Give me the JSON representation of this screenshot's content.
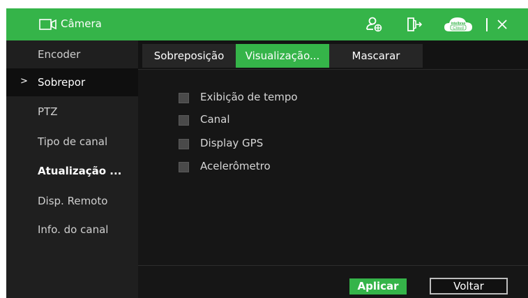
{
  "window": {
    "title": "Câmera",
    "cloud_brand": "intelbras",
    "cloud_label": "Cloud"
  },
  "sidebar": {
    "items": [
      {
        "label": "Encoder"
      },
      {
        "label": "Sobrepor",
        "selected": true
      },
      {
        "label": "PTZ"
      },
      {
        "label": "Tipo de canal"
      },
      {
        "label": "Atualização ..."
      },
      {
        "label": "Disp. Remoto"
      },
      {
        "label": "Info. do canal"
      }
    ],
    "selected_marker": ">"
  },
  "tabs": [
    {
      "label": "Sobreposição"
    },
    {
      "label": "Visualização...",
      "active": true
    },
    {
      "label": "Mascarar"
    }
  ],
  "options": [
    {
      "label": "Exibição de tempo",
      "checked": false
    },
    {
      "label": "Canal",
      "checked": false
    },
    {
      "label": "Display GPS",
      "checked": false
    },
    {
      "label": "Acelerômetro",
      "checked": false
    }
  ],
  "buttons": {
    "apply": "Aplicar",
    "back": "Voltar"
  },
  "colors": {
    "accent": "#35b449",
    "background": "#161616"
  },
  "icons": [
    "camera-icon",
    "user-settings-icon",
    "exit-icon",
    "cloud-icon",
    "close-icon"
  ]
}
